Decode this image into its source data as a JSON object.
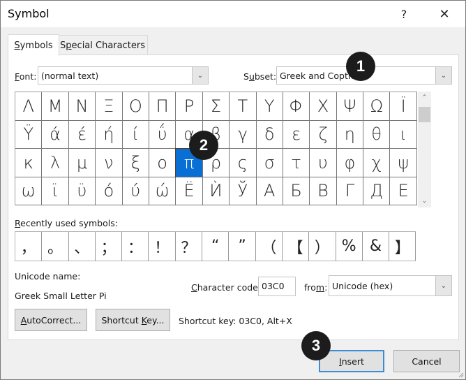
{
  "window": {
    "title": "Symbol",
    "help_label": "?",
    "close_label": "✕"
  },
  "tabs": [
    {
      "label_prefix": "",
      "label_underline": "S",
      "label_rest": "ymbols",
      "active": true
    },
    {
      "label_prefix": "S",
      "label_underline": "p",
      "label_rest": "ecial Characters",
      "active": false
    }
  ],
  "font": {
    "label_underline": "F",
    "label_rest": "ont:",
    "value": "(normal text)"
  },
  "subset": {
    "label_prefix": "S",
    "label_underline": "u",
    "label_rest": "bset:",
    "value": "Greek and Coptic"
  },
  "symbol_grid": {
    "rows": [
      [
        "Λ",
        "Μ",
        "Ν",
        "Ξ",
        "Ο",
        "Π",
        "Ρ",
        "Σ",
        "Τ",
        "Υ",
        "Φ",
        "Χ",
        "Ψ",
        "Ω",
        "Ϊ",
        ""
      ],
      [
        "Ϋ",
        "ά",
        "έ",
        "ή",
        "ί",
        "ΰ",
        "α",
        "β",
        "γ",
        "δ",
        "ε",
        "ζ",
        "η",
        "θ",
        "ι",
        ""
      ],
      [
        "κ",
        "λ",
        "μ",
        "ν",
        "ξ",
        "ο",
        "π",
        "ρ",
        "ς",
        "σ",
        "τ",
        "υ",
        "φ",
        "χ",
        "ψ",
        ""
      ],
      [
        "ω",
        "ϊ",
        "ϋ",
        "ό",
        "ύ",
        "ώ",
        "Ё",
        "Ѝ",
        "Ў",
        "А",
        "Б",
        "В",
        "Г",
        "Д",
        "Е",
        ""
      ]
    ],
    "selected": "π"
  },
  "recent": {
    "label_underline": "R",
    "label_rest": "ecently used symbols:",
    "symbols": [
      "，",
      "。",
      "、",
      "；",
      "：",
      "！",
      "？",
      "“",
      "”",
      "（",
      "【",
      "）",
      "%",
      "&",
      "】"
    ]
  },
  "unicode_name": {
    "label": "Unicode name:",
    "value": "Greek Small Letter Pi"
  },
  "character_code": {
    "label_underline": "C",
    "label_rest": "haracter code:",
    "value": "03C0"
  },
  "from": {
    "label_prefix": "fro",
    "label_underline": "m",
    "label_rest": ":",
    "value": "Unicode (hex)"
  },
  "buttons": {
    "autocorrect": {
      "underline": "A",
      "rest": "utoCorrect..."
    },
    "shortcut_key": {
      "prefix": "Shortcut ",
      "underline": "K",
      "rest": "ey..."
    },
    "insert": {
      "underline": "I",
      "rest": "nsert"
    },
    "cancel": "Cancel"
  },
  "shortcut_key_text": "Shortcut key: 03C0, Alt+X",
  "callouts": [
    "1",
    "2",
    "3"
  ],
  "icons": {
    "chevron_down": "⌄",
    "chevron_up": "⌃"
  }
}
